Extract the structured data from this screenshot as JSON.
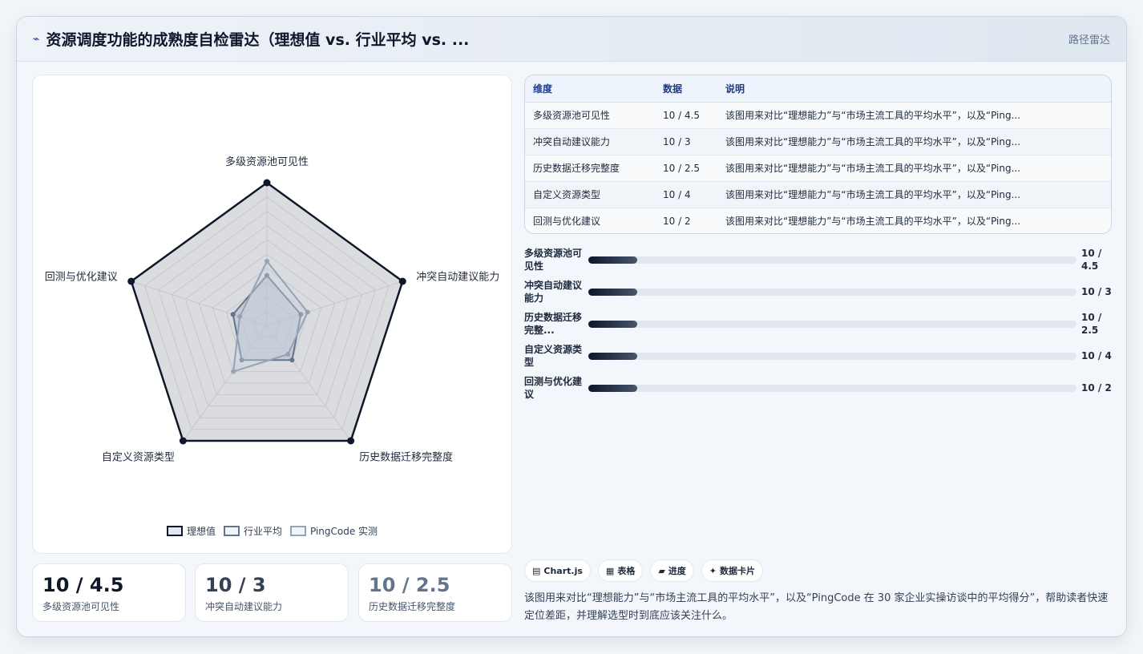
{
  "header": {
    "icon": "line-chart-icon",
    "icon_glyph": "⌁",
    "title": "资源调度功能的成熟度自检雷达（理想值 vs. 行业平均 vs. ...",
    "right_label": "路径雷达"
  },
  "colors": {
    "accent": "#0f172a",
    "industry": "#94a3b8",
    "pingcode": "#cbd5e1"
  },
  "chart_data": {
    "type": "radar",
    "axes": [
      "多级资源池可见性",
      "冲突自动建议能力",
      "历史数据迁移完整度",
      "自定义资源类型",
      "回测与优化建议"
    ],
    "rmax": 10,
    "rings": 10,
    "series": [
      {
        "name": "理想值",
        "values": [
          10,
          10,
          10,
          10,
          10
        ]
      },
      {
        "name": "行业平均",
        "values": [
          3.5,
          2.5,
          3.0,
          3.0,
          2.5
        ]
      },
      {
        "name": "PingCode 实测",
        "values": [
          4.5,
          3,
          2.5,
          4,
          2
        ]
      }
    ]
  },
  "kpis": [
    {
      "value": "10 / 4.5",
      "label": "多级资源池可见性",
      "color": "#0f172a"
    },
    {
      "value": "10 / 3",
      "label": "冲突自动建议能力",
      "color": "#334155"
    },
    {
      "value": "10 / 2.5",
      "label": "历史数据迁移完整度",
      "color": "#64748b"
    }
  ],
  "table": {
    "headers": [
      "维度",
      "数据",
      "说明"
    ],
    "rows": [
      [
        "多级资源池可见性",
        "10 / 4.5",
        "该图用来对比“理想能力”与“市场主流工具的平均水平”，以及“Ping..."
      ],
      [
        "冲突自动建议能力",
        "10 / 3",
        "该图用来对比“理想能力”与“市场主流工具的平均水平”，以及“Ping..."
      ],
      [
        "历史数据迁移完整度",
        "10 / 2.5",
        "该图用来对比“理想能力”与“市场主流工具的平均水平”，以及“Ping..."
      ],
      [
        "自定义资源类型",
        "10 / 4",
        "该图用来对比“理想能力”与“市场主流工具的平均水平”，以及“Ping..."
      ],
      [
        "回测与优化建议",
        "10 / 2",
        "该图用来对比“理想能力”与“市场主流工具的平均水平”，以及“Ping..."
      ]
    ]
  },
  "bars": [
    {
      "label": "多级资源池可见性",
      "value_text": "10 / 4.5",
      "fill_fraction": 0.1
    },
    {
      "label": "冲突自动建议能力",
      "value_text": "10 / 3",
      "fill_fraction": 0.1
    },
    {
      "label": "历史数据迁移完整...",
      "value_text": "10 / 2.5",
      "fill_fraction": 0.1
    },
    {
      "label": "自定义资源类型",
      "value_text": "10 / 4",
      "fill_fraction": 0.1
    },
    {
      "label": "回测与优化建议",
      "value_text": "10 / 2",
      "fill_fraction": 0.1
    }
  ],
  "chips": [
    {
      "icon": "chart-icon",
      "glyph": "▤",
      "label": "Chart.js"
    },
    {
      "icon": "table-icon",
      "glyph": "▦",
      "label": "表格"
    },
    {
      "icon": "progress-icon",
      "glyph": "▰",
      "label": "进度"
    },
    {
      "icon": "sparkle-icon",
      "glyph": "✦",
      "label": "数据卡片"
    }
  ],
  "description": "该图用来对比“理想能力”与“市场主流工具的平均水平”，以及“PingCode 在 30 家企业实操访谈中的平均得分”，帮助读者快速定位差距，并理解选型时到底应该关注什么。"
}
